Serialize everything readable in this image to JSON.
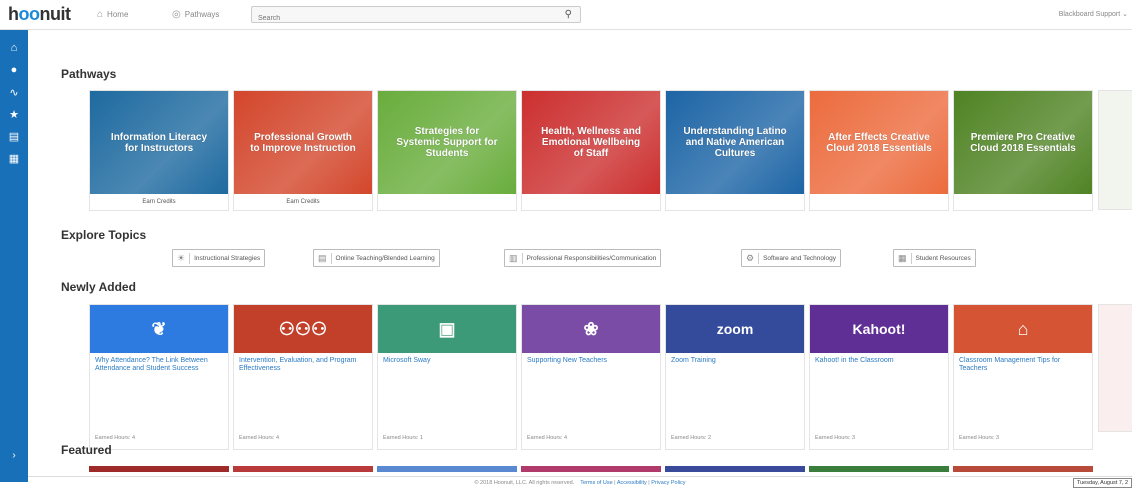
{
  "app": {
    "logo_pre": "h",
    "logo_oo": "oo",
    "logo_post": "nuit"
  },
  "nav": {
    "home": "Home",
    "pathways": "Pathways"
  },
  "search": {
    "placeholder": "Search"
  },
  "user_menu": "Blackboard Support ⌄",
  "sections": {
    "pathways": "Pathways",
    "explore": "Explore Topics",
    "newly_added": "Newly Added",
    "featured": "Featured"
  },
  "pathways": [
    {
      "title": "Information Literacy for Instructors",
      "footer": "Earn Credits",
      "color": "#1e6aa0"
    },
    {
      "title": "Professional Growth to Improve Instruction",
      "footer": "Earn Credits",
      "color": "#d3462b"
    },
    {
      "title": "Strategies for Systemic Support for Students",
      "footer": "",
      "color": "#69ad3c"
    },
    {
      "title": "Health, Wellness and Emotional Wellbeing of Staff",
      "footer": "",
      "color": "#cc2f2f"
    },
    {
      "title": "Understanding Latino and Native American Cultures",
      "footer": "",
      "color": "#1d65a6"
    },
    {
      "title": "After Effects Creative Cloud 2018 Essentials",
      "footer": "",
      "color": "#ec6b3d"
    },
    {
      "title": "Premiere Pro Creative Cloud 2018 Essentials",
      "footer": "",
      "color": "#4f8323"
    }
  ],
  "topics": [
    {
      "label": "Instructional Strategies",
      "icon": "lightbulb-icon"
    },
    {
      "label": "Online Teaching/Blended Learning",
      "icon": "screen-icon"
    },
    {
      "label": "Professional Responsibilities/Communication",
      "icon": "document-icon"
    },
    {
      "label": "Software and Technology",
      "icon": "gear-icon"
    },
    {
      "label": "Student Resources",
      "icon": "books-icon"
    }
  ],
  "newly_added": [
    {
      "title": "Why Attendance? The Link Between Attendance and Student Success",
      "hours": "Earned Hours: 4",
      "color": "#2d7ae0",
      "glyph": "❦"
    },
    {
      "title": "Intervention, Evaluation, and Program Effectiveness",
      "hours": "Earned Hours: 4",
      "color": "#c2402a",
      "glyph": "⚇⚇⚇"
    },
    {
      "title": "Microsoft Sway",
      "hours": "Earned Hours: 1",
      "color": "#3c9a78",
      "glyph": "▣"
    },
    {
      "title": "Supporting New Teachers",
      "hours": "Earned Hours: 4",
      "color": "#7b4ca6",
      "glyph": "❀"
    },
    {
      "title": "Zoom Training",
      "hours": "Earned Hours: 2",
      "color": "#344a9a",
      "glyph": "zoom"
    },
    {
      "title": "Kahoot! in the Classroom",
      "hours": "Earned Hours: 3",
      "color": "#5f2f96",
      "glyph": "Kahoot!"
    },
    {
      "title": "Classroom Management Tips for Teachers",
      "hours": "Earned Hours: 3",
      "color": "#d55433",
      "glyph": "⌂"
    }
  ],
  "featured_colors": [
    "#9e2a2a",
    "#b83a3a",
    "#5a88d1",
    "#b03a6a",
    "#3a4a9a",
    "#3b7d3b",
    "#b84a3a"
  ],
  "footer": {
    "copyright": "© 2018 Hoonuit, LLC. All rights reserved.",
    "terms": "Terms of Use",
    "accessibility": "Accessibility",
    "privacy": "Privacy Policy"
  },
  "date": "Tuesday, August 7, 2"
}
